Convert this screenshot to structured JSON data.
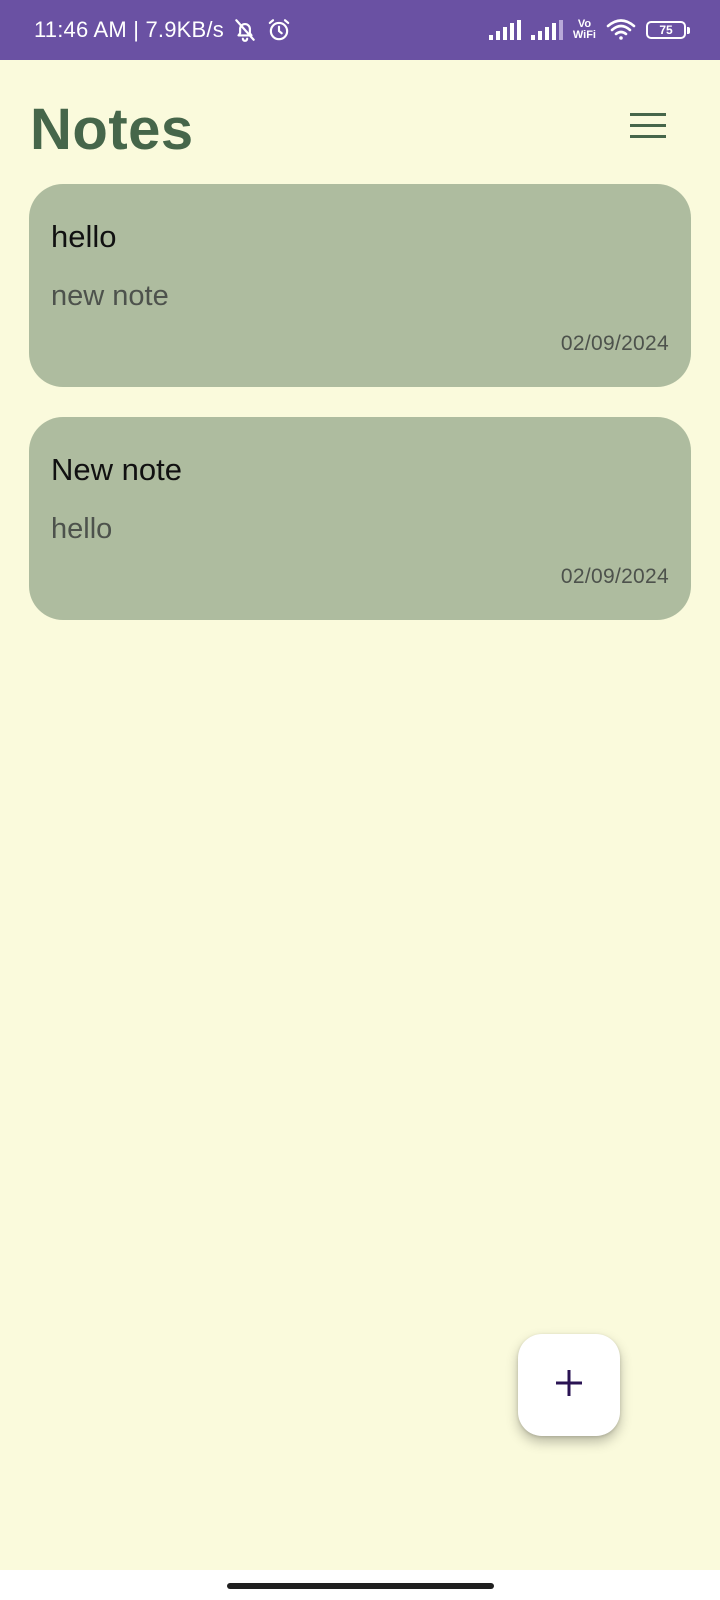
{
  "status_bar": {
    "time_speed": "11:46 AM | 7.9KB/s",
    "vo_label": "Vo",
    "wifi_label": "WiFi",
    "battery_level": "75",
    "icons": [
      "bell-off-icon",
      "alarm-icon",
      "signal-icon",
      "signal-icon",
      "wifi-icon",
      "battery-icon"
    ]
  },
  "header": {
    "title": "Notes",
    "menu_icon": "hamburger-menu-icon"
  },
  "notes": [
    {
      "title": "hello",
      "body": "new note",
      "date": "02/09/2024"
    },
    {
      "title": "New note",
      "body": "hello",
      "date": "02/09/2024"
    }
  ],
  "fab": {
    "icon": "plus-icon",
    "label": "+"
  },
  "colors": {
    "status_bar": "#6a51a3",
    "background": "#fafadc",
    "title": "#46664a",
    "card": "#aebc9f",
    "fab_icon": "#2a1353"
  }
}
